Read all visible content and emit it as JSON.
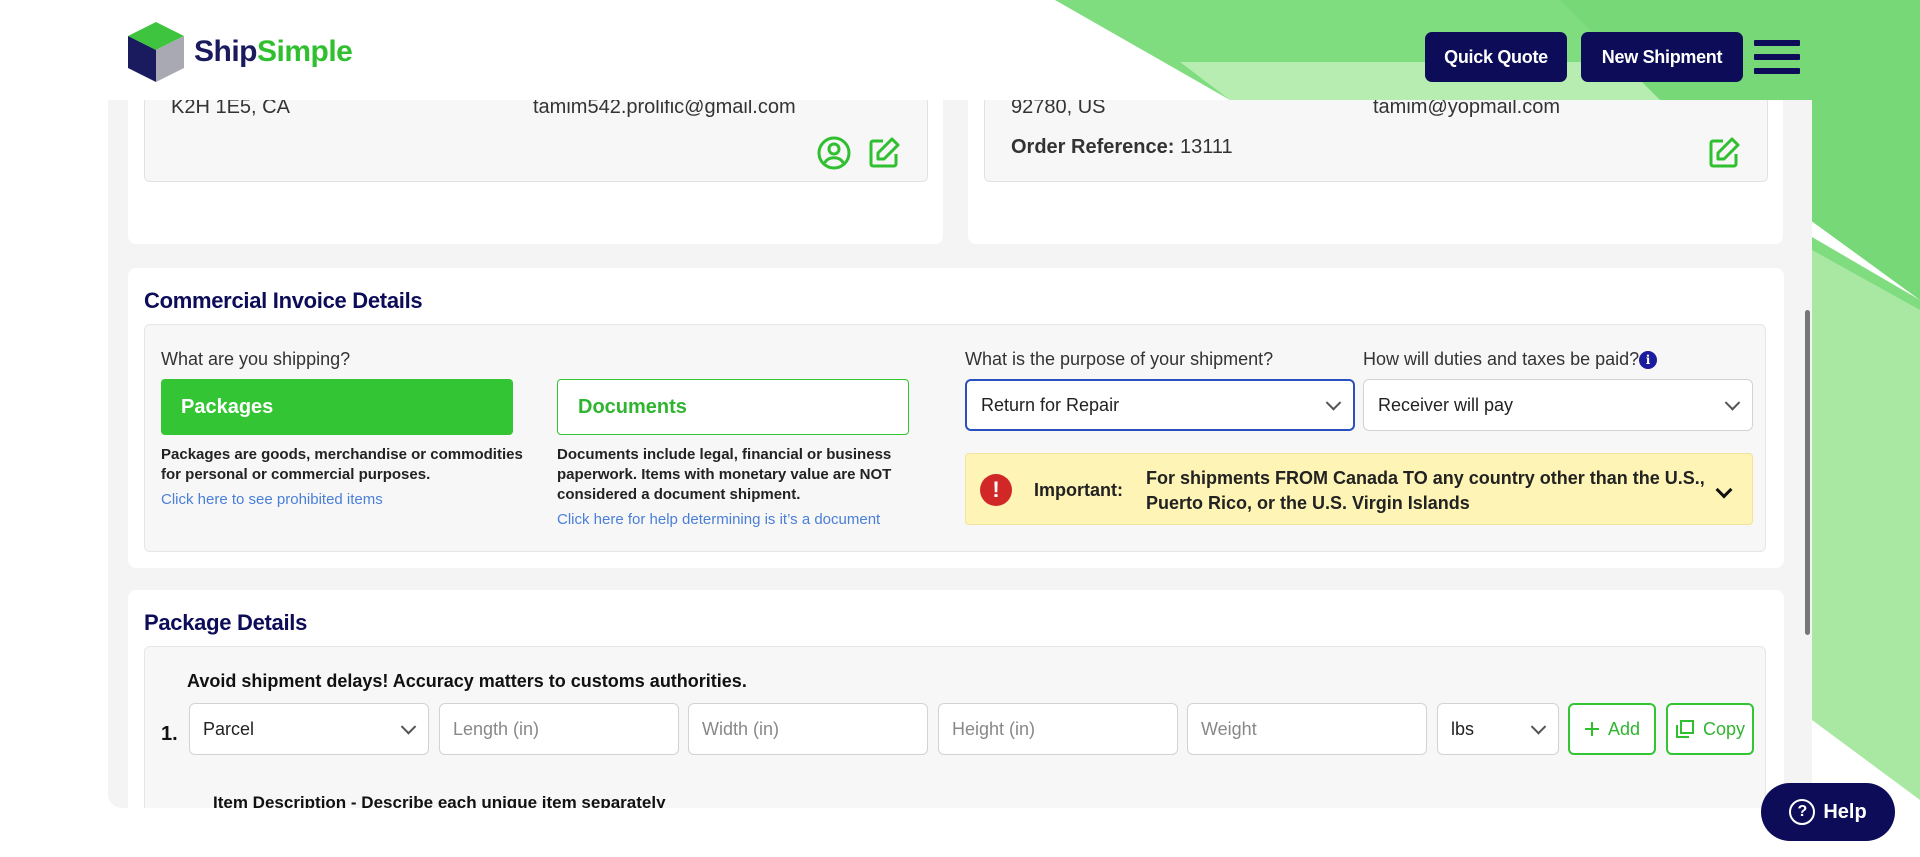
{
  "brand": {
    "ship": "Ship",
    "simple": "Simple"
  },
  "header": {
    "quick_quote": "Quick Quote",
    "new_shipment": "New Shipment"
  },
  "sender": {
    "postal": "K2H 1E5, CA",
    "email": "tamim542.prolific@gmail.com"
  },
  "receiver": {
    "postal": "92780, US",
    "email": "tamim@yopmail.com",
    "order_ref_label": "Order Reference:",
    "order_ref_value": "13111"
  },
  "invoice": {
    "title": "Commercial Invoice Details",
    "shipping_question": "What are you shipping?",
    "packages_label": "Packages",
    "documents_label": "Documents",
    "packages_desc": "Packages are goods, merchandise or commodities for personal or commercial purposes.",
    "packages_link": "Click here to see prohibited items",
    "documents_desc": "Documents include legal, financial or business paperwork. Items with monetary value are NOT considered a document shipment.",
    "documents_link": "Click here for help determining is it’s a document",
    "purpose_question": "What is the purpose of your shipment?",
    "purpose_value": "Return for Repair",
    "duties_question": "How will duties and taxes be paid?",
    "duties_value": "Receiver will pay",
    "important_label": "Important:",
    "important_text": "For shipments FROM Canada TO any country other than the U.S., Puerto Rico, or the U.S. Virgin Islands"
  },
  "package": {
    "title": "Package Details",
    "warning": "Avoid shipment delays! Accuracy matters to customs authorities.",
    "row_number": "1.",
    "type_value": "Parcel",
    "length_placeholder": "Length (in)",
    "width_placeholder": "Width (in)",
    "height_placeholder": "Height (in)",
    "weight_placeholder": "Weight",
    "unit_value": "lbs",
    "add_label": "Add",
    "copy_label": "Copy",
    "item_desc_label": "Item Description - Describe each unique item separately"
  },
  "help": {
    "label": "Help"
  },
  "colors": {
    "navy": "#0c0c58",
    "green": "#33c533",
    "alert_bg": "#fdf4b6"
  }
}
